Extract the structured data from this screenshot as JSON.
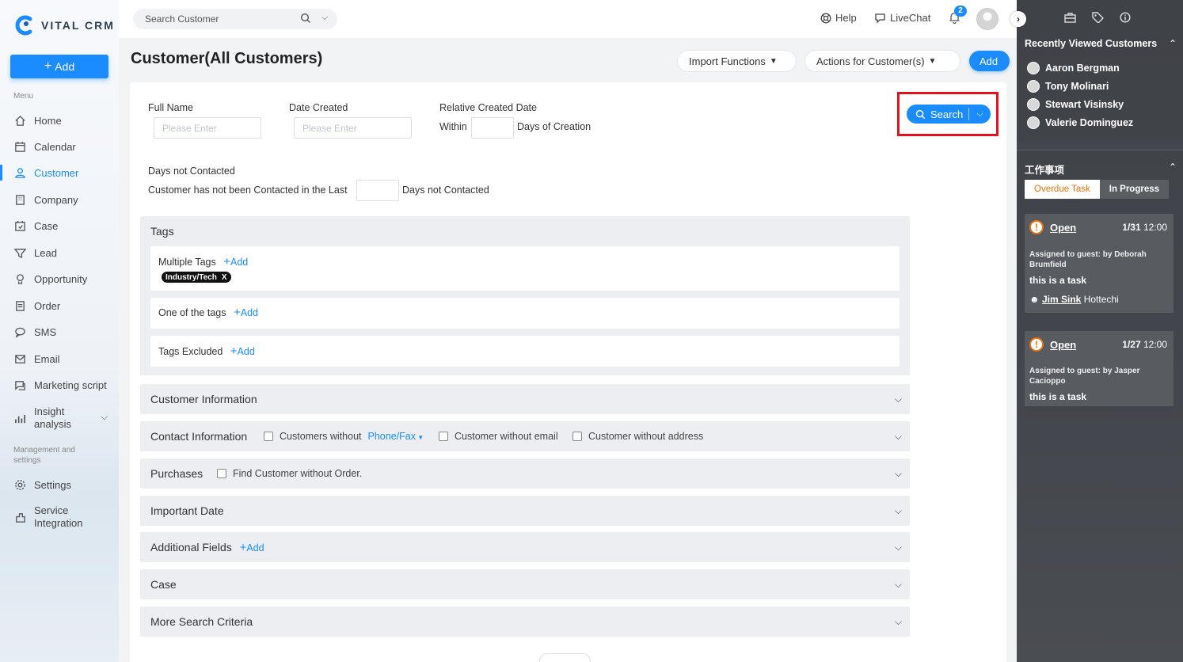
{
  "app": {
    "logo_text": "VITAL CRM"
  },
  "sidebar": {
    "add_label": "Add",
    "menu_label": "Menu",
    "items": [
      {
        "label": "Home",
        "icon": "home-icon"
      },
      {
        "label": "Calendar",
        "icon": "calendar-icon"
      },
      {
        "label": "Customer",
        "icon": "customer-icon"
      },
      {
        "label": "Company",
        "icon": "company-icon"
      },
      {
        "label": "Case",
        "icon": "case-icon"
      },
      {
        "label": "Lead",
        "icon": "lead-icon"
      },
      {
        "label": "Opportunity",
        "icon": "opportunity-icon"
      },
      {
        "label": "Order",
        "icon": "order-icon"
      },
      {
        "label": "SMS",
        "icon": "sms-icon"
      },
      {
        "label": "Email",
        "icon": "email-icon"
      },
      {
        "label": "Marketing script",
        "icon": "marketing-icon"
      },
      {
        "label": "Insight analysis",
        "icon": "insight-icon"
      }
    ],
    "management_label": "Management and settings",
    "management_items": [
      {
        "label": "Settings",
        "icon": "gear-icon"
      },
      {
        "label": "Service Integration",
        "icon": "integration-icon"
      }
    ],
    "active": "Customer"
  },
  "topbar": {
    "search_placeholder": "Search Customer",
    "help_label": "Help",
    "livechat_label": "LiveChat",
    "notification_count": "2"
  },
  "header": {
    "title": "Customer(All Customers)",
    "import_label": "Import Functions",
    "actions_label": "Actions for Customer(s)",
    "add_label": "Add"
  },
  "filters": {
    "full_name_label": "Full Name",
    "full_name_placeholder": "Please Enter",
    "date_created_label": "Date Created",
    "date_created_placeholder": "Please Enter",
    "relative_label": "Relative Created Date",
    "within_label": "Within",
    "days_of_creation_label": "Days of Creation",
    "days_not_contacted_title": "Days not Contacted",
    "not_contacted_prefix": "Customer has not been Contacted in the Last",
    "not_contacted_suffix": "Days not Contacted",
    "search_label": "Search"
  },
  "tags": {
    "title": "Tags",
    "multiple_label": "Multiple Tags",
    "one_of_label": "One of the tags",
    "excluded_label": "Tags Excluded",
    "add_label": "Add",
    "chip_label": "Industry/Tech",
    "chip_remove": "X"
  },
  "sections": {
    "customer_info": "Customer Information",
    "contact_info": "Contact Information",
    "customers_without": "Customers without",
    "phone_fax": "Phone/Fax",
    "without_email": "Customer without email",
    "without_address": "Customer without address",
    "purchases": "Purchases",
    "without_order": "Find Customer without Order.",
    "important_date": "Important Date",
    "additional_fields": "Additional Fields",
    "additional_add": "Add",
    "case": "Case",
    "more_criteria": "More Search Criteria"
  },
  "right_panel": {
    "recent_title": "Recently Viewed Customers",
    "recent": [
      "Aaron Bergman",
      "Tony Molinari",
      "Stewart Visinsky",
      "Valerie Dominguez"
    ],
    "work_title": "工作事项",
    "tab_overdue": "Overdue Task",
    "tab_progress": "In Progress",
    "tasks": [
      {
        "status": "Open",
        "date": "1/31",
        "time": "12:00",
        "assigned": "Assigned to guest: by Deborah Brumfield",
        "desc": "this is a task",
        "person_link": "Jim Sink",
        "person_rest": "Hottechi"
      },
      {
        "status": "Open",
        "date": "1/27",
        "time": "12:00",
        "assigned": "Assigned to guest: by Jasper Cacioppo",
        "desc": "this is a task"
      }
    ]
  },
  "colors": {
    "accent": "#1a8cff",
    "highlight_box": "#e1141e",
    "overdue": "#e8730c"
  }
}
